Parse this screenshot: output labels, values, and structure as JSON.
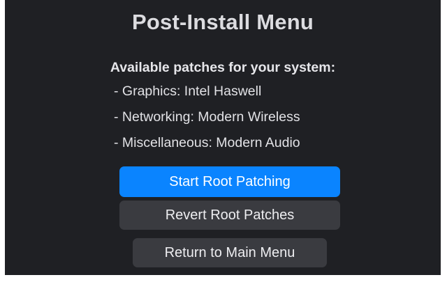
{
  "window": {
    "title": "Post-Install Menu"
  },
  "main": {
    "subtitle": "Available patches for your system:",
    "patches": [
      "- Graphics: Intel Haswell",
      "- Networking: Modern Wireless",
      "- Miscellaneous: Modern Audio"
    ]
  },
  "buttons": {
    "start_label": "Start Root Patching",
    "revert_label": "Revert Root Patches",
    "return_label": "Return to Main Menu"
  },
  "colors": {
    "background": "#1f2024",
    "accent": "#0a84ff",
    "button_secondary": "#3a3b40"
  }
}
